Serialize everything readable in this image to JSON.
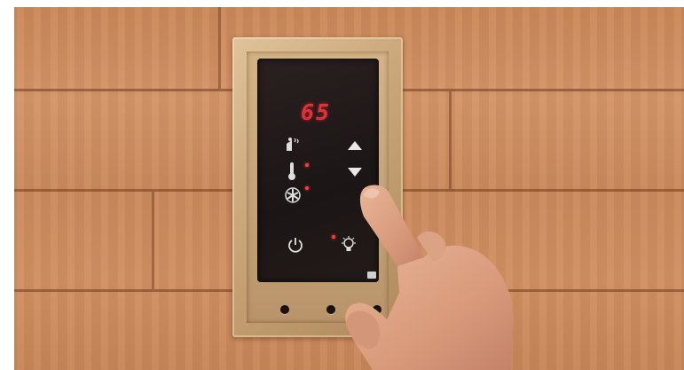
{
  "scene": {
    "description_type": "sauna-control-panel-photo"
  },
  "display": {
    "temperature": "65"
  },
  "controls": {
    "up_arrow": "up-arrow-icon",
    "down_arrow": "down-arrow-icon",
    "sauna_icon": "sauna-heater-icon",
    "thermometer_icon": "thermometer-icon",
    "fan_icon": "fan-icon",
    "power_icon": "power-icon",
    "light_icon": "light-bulb-icon"
  },
  "colors": {
    "led": "#e0323a",
    "panel": "#1b1515",
    "wood": "#cc8d60"
  }
}
